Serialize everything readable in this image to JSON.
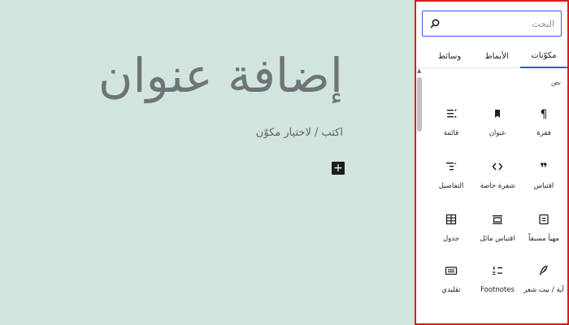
{
  "editor": {
    "title": "إضافة عنوان",
    "appender_hint": "اكتب / لاختيار مكوّن",
    "add_block_symbol": "+"
  },
  "inserter": {
    "search_placeholder": "البحث",
    "tabs": [
      {
        "label": "مكوّنات",
        "selected": true
      },
      {
        "label": "الأنماط",
        "selected": false
      },
      {
        "label": "وسائط",
        "selected": false
      }
    ],
    "category_label": "نص",
    "blocks": [
      {
        "label": "فقرة",
        "icon": "paragraph-icon"
      },
      {
        "label": "عنوان",
        "icon": "heading-icon"
      },
      {
        "label": "قائمة",
        "icon": "list-icon"
      },
      {
        "label": "اقتباس",
        "icon": "quote-icon"
      },
      {
        "label": "شفرة خاصة",
        "icon": "code-icon"
      },
      {
        "label": "التفاصيل",
        "icon": "details-icon"
      },
      {
        "label": "مهيأ مسبقاً",
        "icon": "preformatted-icon"
      },
      {
        "label": "اقتباس مائل",
        "icon": "pullquote-icon"
      },
      {
        "label": "جدول",
        "icon": "table-icon"
      },
      {
        "label": "آية / بيت شعر",
        "icon": "verse-icon"
      },
      {
        "label": "Footnotes",
        "icon": "footnotes-icon"
      },
      {
        "label": "تقليدي",
        "icon": "classic-icon"
      }
    ]
  },
  "colors": {
    "canvas_background": "#d2e4de",
    "accent": "#3858e9",
    "highlight_border": "#d61b1b"
  }
}
